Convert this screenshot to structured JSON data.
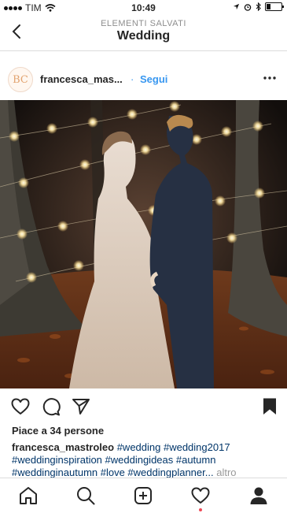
{
  "status_bar": {
    "carrier": "TIM",
    "time": "10:49"
  },
  "nav": {
    "subtitle": "ELEMENTI SALVATI",
    "title": "Wedding"
  },
  "post": {
    "avatar_text": "BC",
    "username_short": "francesca_mas...",
    "separator": "·",
    "follow_label": "Segui",
    "likes": "Piace a 34 persone",
    "caption": {
      "username": "francesca_mastroleo",
      "line1_tags": "#wedding #wedding2017",
      "line2": "#weddinginspiration #weddingideas #autumn",
      "line3": "#weddinginautumn #love #weddingplanner...",
      "more": "altro"
    }
  },
  "colors": {
    "accent": "#3897f0",
    "hashtag": "#003569",
    "notification": "#ed4956"
  }
}
